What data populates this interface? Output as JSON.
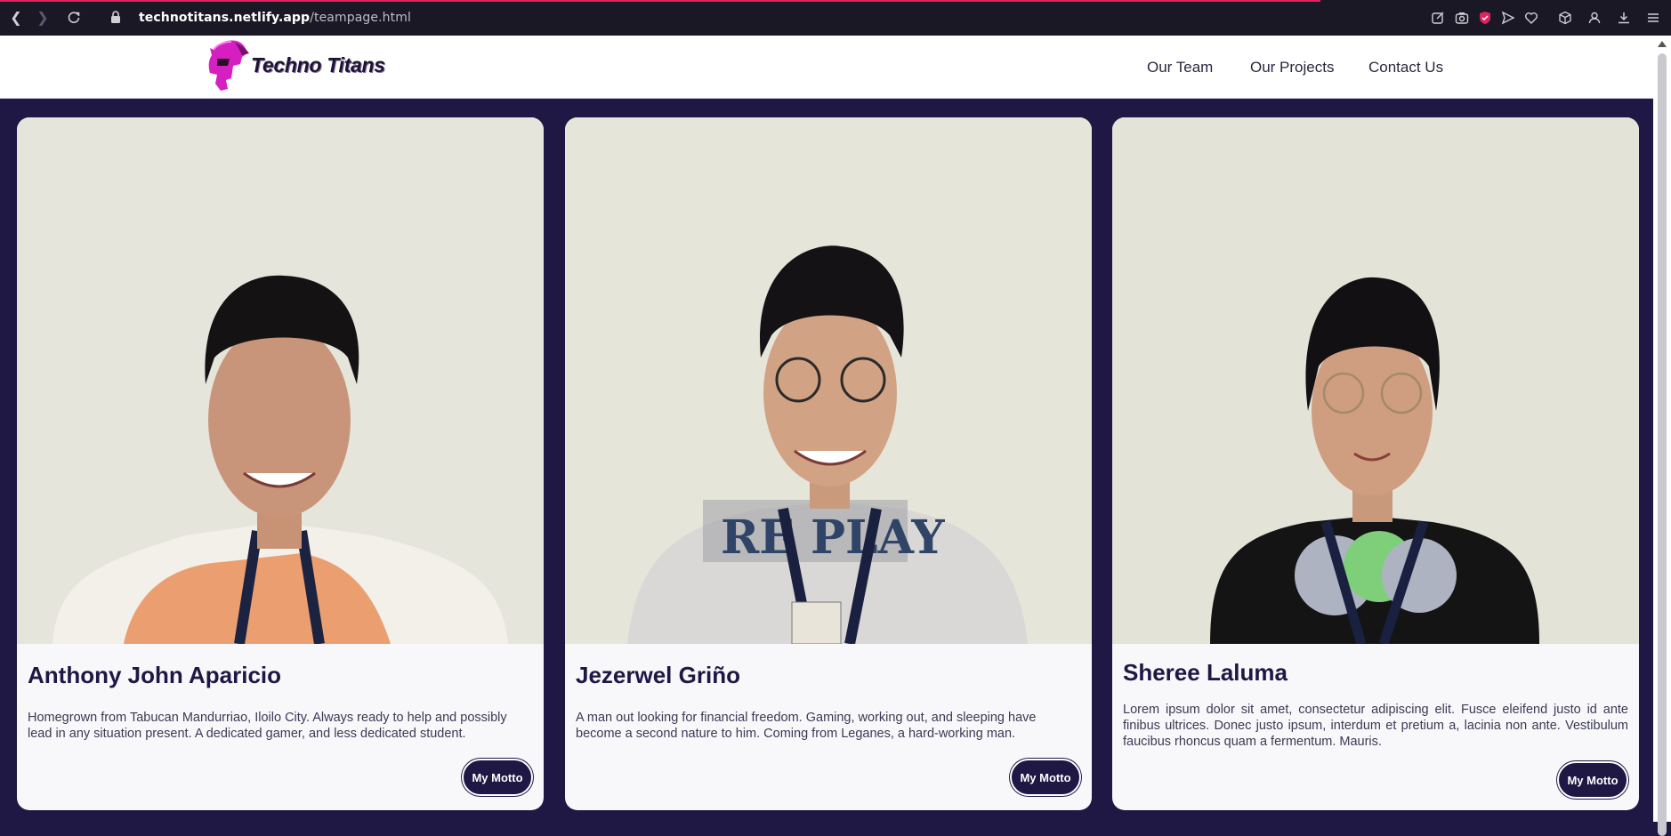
{
  "browser": {
    "url_domain": "technotitans.netlify.app",
    "url_path": "/teampage.html",
    "toolbar_icons": [
      "edit-icon",
      "camera-icon",
      "shield-icon",
      "send-icon",
      "heart-icon",
      "cube-icon",
      "profile-icon",
      "download-icon",
      "menu-icon"
    ]
  },
  "site": {
    "brand": "Techno Titans",
    "nav": [
      "Our Team",
      "Our Projects",
      "Contact Us"
    ],
    "colors": {
      "accent": "#1f1744",
      "logo": "#d61fc1",
      "page_bg": "#1f1744"
    }
  },
  "members": [
    {
      "name": "Anthony John Aparicio",
      "bio": "Homegrown from Tabucan Mandurriao, Iloilo City. Always ready to help and possibly lead in any situation present. A dedicated gamer, and less dedicated student.",
      "button": "My Motto"
    },
    {
      "name": "Jezerwel Griño",
      "bio": "A man out looking for financial freedom. Gaming, working out, and sleeping have become a second nature to him. Coming from Leganes, a hard-working man.",
      "button": "My Motto"
    },
    {
      "name": "Sheree Laluma",
      "bio": "Lorem ipsum dolor sit amet, consectetur adipiscing elit. Fusce eleifend justo id ante finibus ultrices. Donec justo ipsum, interdum et pretium a, lacinia non ante. Vestibulum faucibus rhoncus quam a fermentum. Mauris.",
      "button": "My Motto"
    }
  ]
}
